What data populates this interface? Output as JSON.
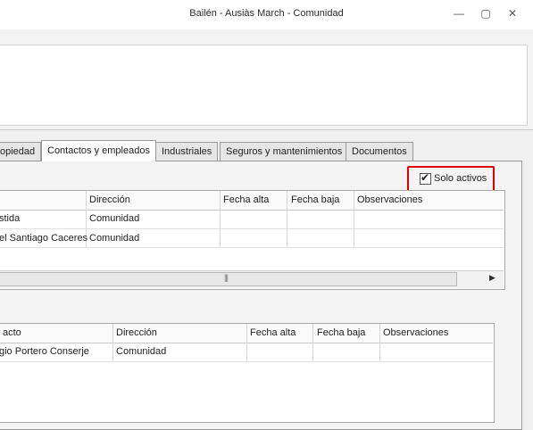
{
  "window": {
    "title": "Bailén - Ausiàs March - Comunidad",
    "min_glyph": "—",
    "max_glyph": "▢",
    "close_glyph": "✕"
  },
  "tabs": [
    {
      "label": "opiedad"
    },
    {
      "label": "Contactos y empleados",
      "active": true
    },
    {
      "label": "Industriales"
    },
    {
      "label": "Seguros y mantenimientos"
    },
    {
      "label": "Documentos"
    }
  ],
  "filter": {
    "solo_activos_label": "Solo activos",
    "checked": true,
    "check_glyph": "✔"
  },
  "grid1": {
    "headers": [
      "",
      "Dirección",
      "Fecha alta",
      "Fecha baja",
      "Observaciones"
    ],
    "rows": [
      [
        "stida",
        "Comunidad",
        "",
        "",
        ""
      ],
      [
        "el Santiago Caceres",
        "Comunidad",
        "",
        "",
        ""
      ]
    ],
    "scroll_grip": "|||",
    "scroll_right": "▶"
  },
  "grid2": {
    "headers": [
      "acto",
      "Dirección",
      "Fecha alta",
      "Fecha baja",
      "Observaciones"
    ],
    "rows": [
      [
        "gio Portero Conserje",
        "Comunidad",
        "",
        "",
        ""
      ]
    ]
  },
  "colors": {
    "highlight": "#e00000",
    "grid_border": "#a8a8a8"
  }
}
